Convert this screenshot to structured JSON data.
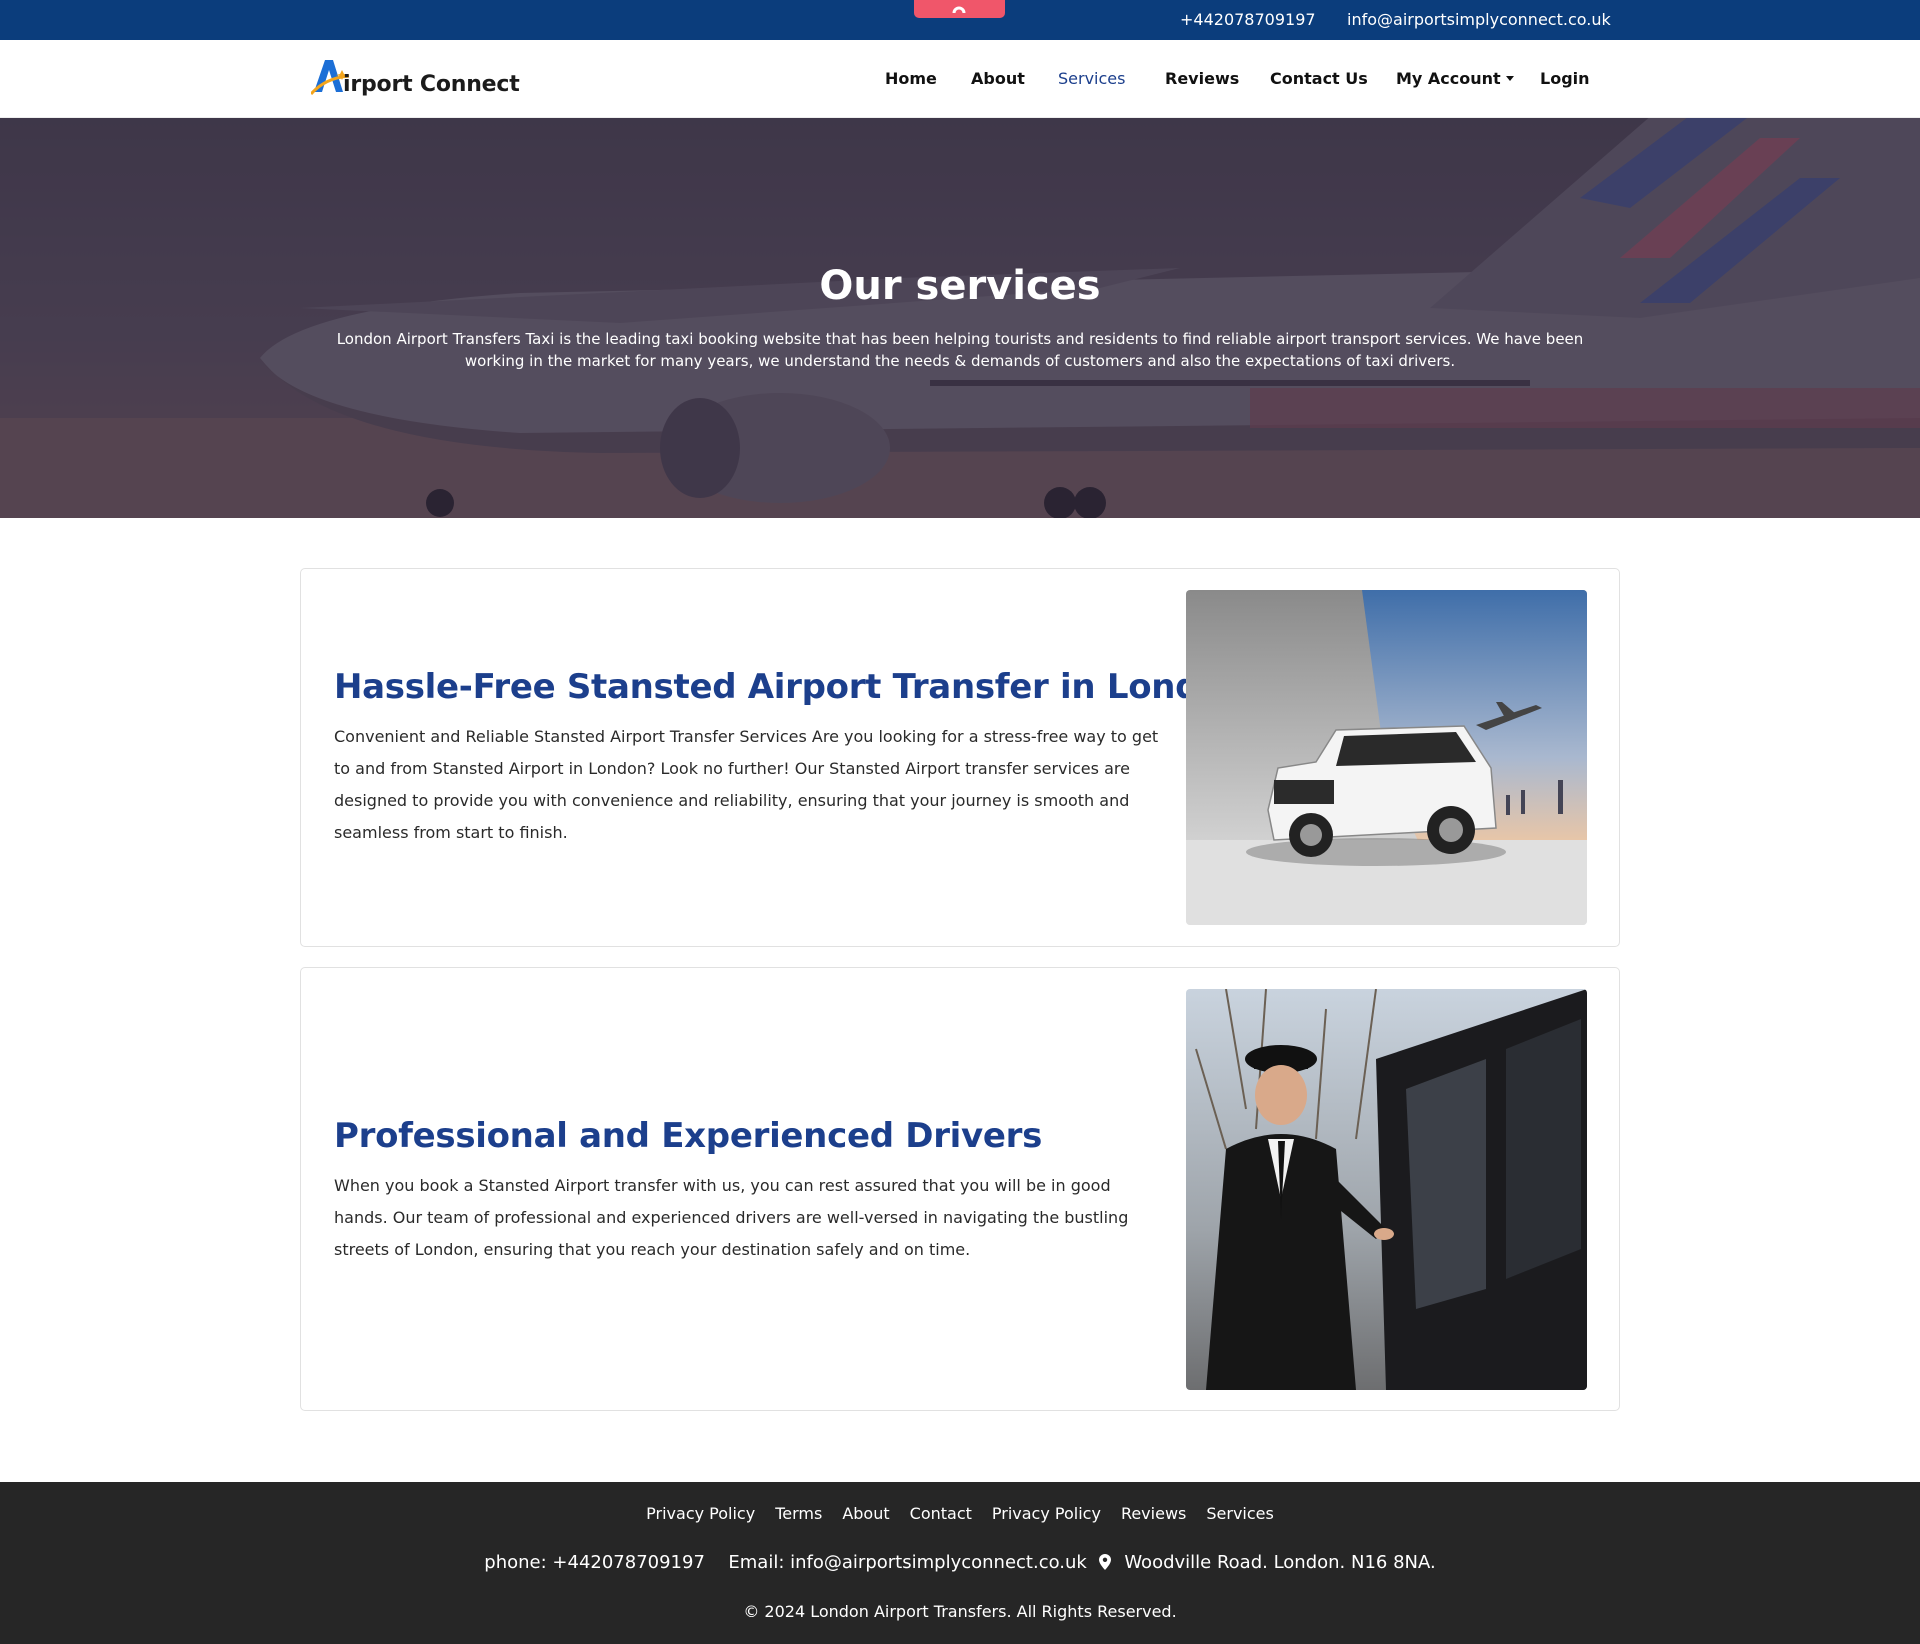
{
  "topbar": {
    "phone": "+442078709197",
    "email": "info@airportsimplyconnect.co.uk"
  },
  "navbar": {
    "logo_text": "irport Connect",
    "logo_letter": "A",
    "items": [
      {
        "label": "Home"
      },
      {
        "label": "About"
      },
      {
        "label": "Services",
        "active": true
      },
      {
        "label": "Reviews"
      },
      {
        "label": "Contact Us"
      },
      {
        "label": "My Account",
        "dropdown": true
      },
      {
        "label": "Login"
      }
    ]
  },
  "hero": {
    "title": "Our services",
    "text": "London Airport Transfers Taxi is the leading taxi booking website that has been helping tourists and residents to find reliable airport transport services. We have been working in the market for many years, we understand the needs & demands of customers and also the expectations of taxi drivers."
  },
  "services": [
    {
      "title": "Hassle-Free Stansted Airport Transfer in London",
      "text": "Convenient and Reliable Stansted Airport Transfer Services Are you looking for a stress-free way to get to and from Stansted Airport in London? Look no further! Our Stansted Airport transfer services are designed to provide you with convenience and reliability, ensuring that your journey is smooth and seamless from start to finish."
    },
    {
      "title": "Professional and Experienced Drivers",
      "text": "When you book a Stansted Airport transfer with us, you can rest assured that you will be in good hands. Our team of professional and experienced drivers are well-versed in navigating the bustling streets of London, ensuring that you reach your destination safely and on time."
    }
  ],
  "footer": {
    "links": [
      "Privacy Policy",
      "Terms",
      "About",
      "Contact",
      "Privacy Policy",
      "Reviews",
      "Services"
    ],
    "phone_label": "phone:",
    "phone": "+442078709197",
    "email_label": "Email:",
    "email": "info@airportsimplyconnect.co.uk",
    "address": "Woodville Road. London. N16 8NA.",
    "copyright": "© 2024 London Airport Transfers. All Rights Reserved."
  },
  "colors": {
    "topbar": "#0b3d7c",
    "accent_tab": "#f0566a",
    "heading_blue": "#1c3f8c",
    "footer_bg": "#262626"
  },
  "icons": [
    "scroll-up-icon",
    "location-pin-icon"
  ]
}
